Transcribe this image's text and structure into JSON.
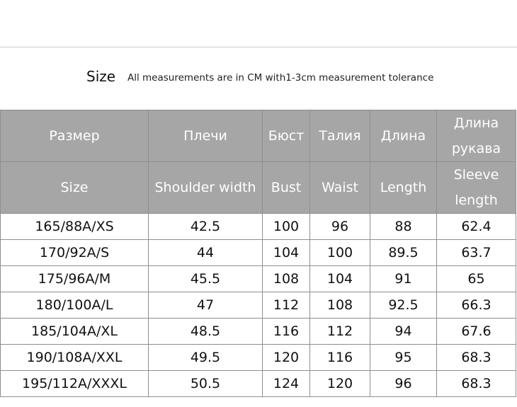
{
  "header": {
    "title": "Size",
    "note": "All measurements are in CM with1-3cm measurement tolerance"
  },
  "table": {
    "headers_ru": [
      "Размер",
      "Плечи",
      "Бюст",
      "Талия",
      "Длина",
      "Длина рукава"
    ],
    "headers_en": [
      "Size",
      "Shoulder width",
      "Bust",
      "Waist",
      "Length",
      "Sleeve length"
    ],
    "rows": [
      [
        "165/88A/XS",
        "42.5",
        "100",
        "96",
        "88",
        "62.4"
      ],
      [
        "170/92A/S",
        "44",
        "104",
        "100",
        "89.5",
        "63.7"
      ],
      [
        "175/96A/M",
        "45.5",
        "108",
        "104",
        "91",
        "65"
      ],
      [
        "180/100A/L",
        "47",
        "112",
        "108",
        "92.5",
        "66.3"
      ],
      [
        "185/104A/XL",
        "48.5",
        "116",
        "112",
        "94",
        "67.6"
      ],
      [
        "190/108A/XXL",
        "49.5",
        "120",
        "116",
        "95",
        "68.3"
      ],
      [
        "195/112A/XXXL",
        "50.5",
        "124",
        "120",
        "96",
        "68.3"
      ]
    ]
  },
  "colors": {
    "header_bg": "#a6a6a6",
    "header_text": "#ffffff",
    "border": "#8f8f8f"
  }
}
